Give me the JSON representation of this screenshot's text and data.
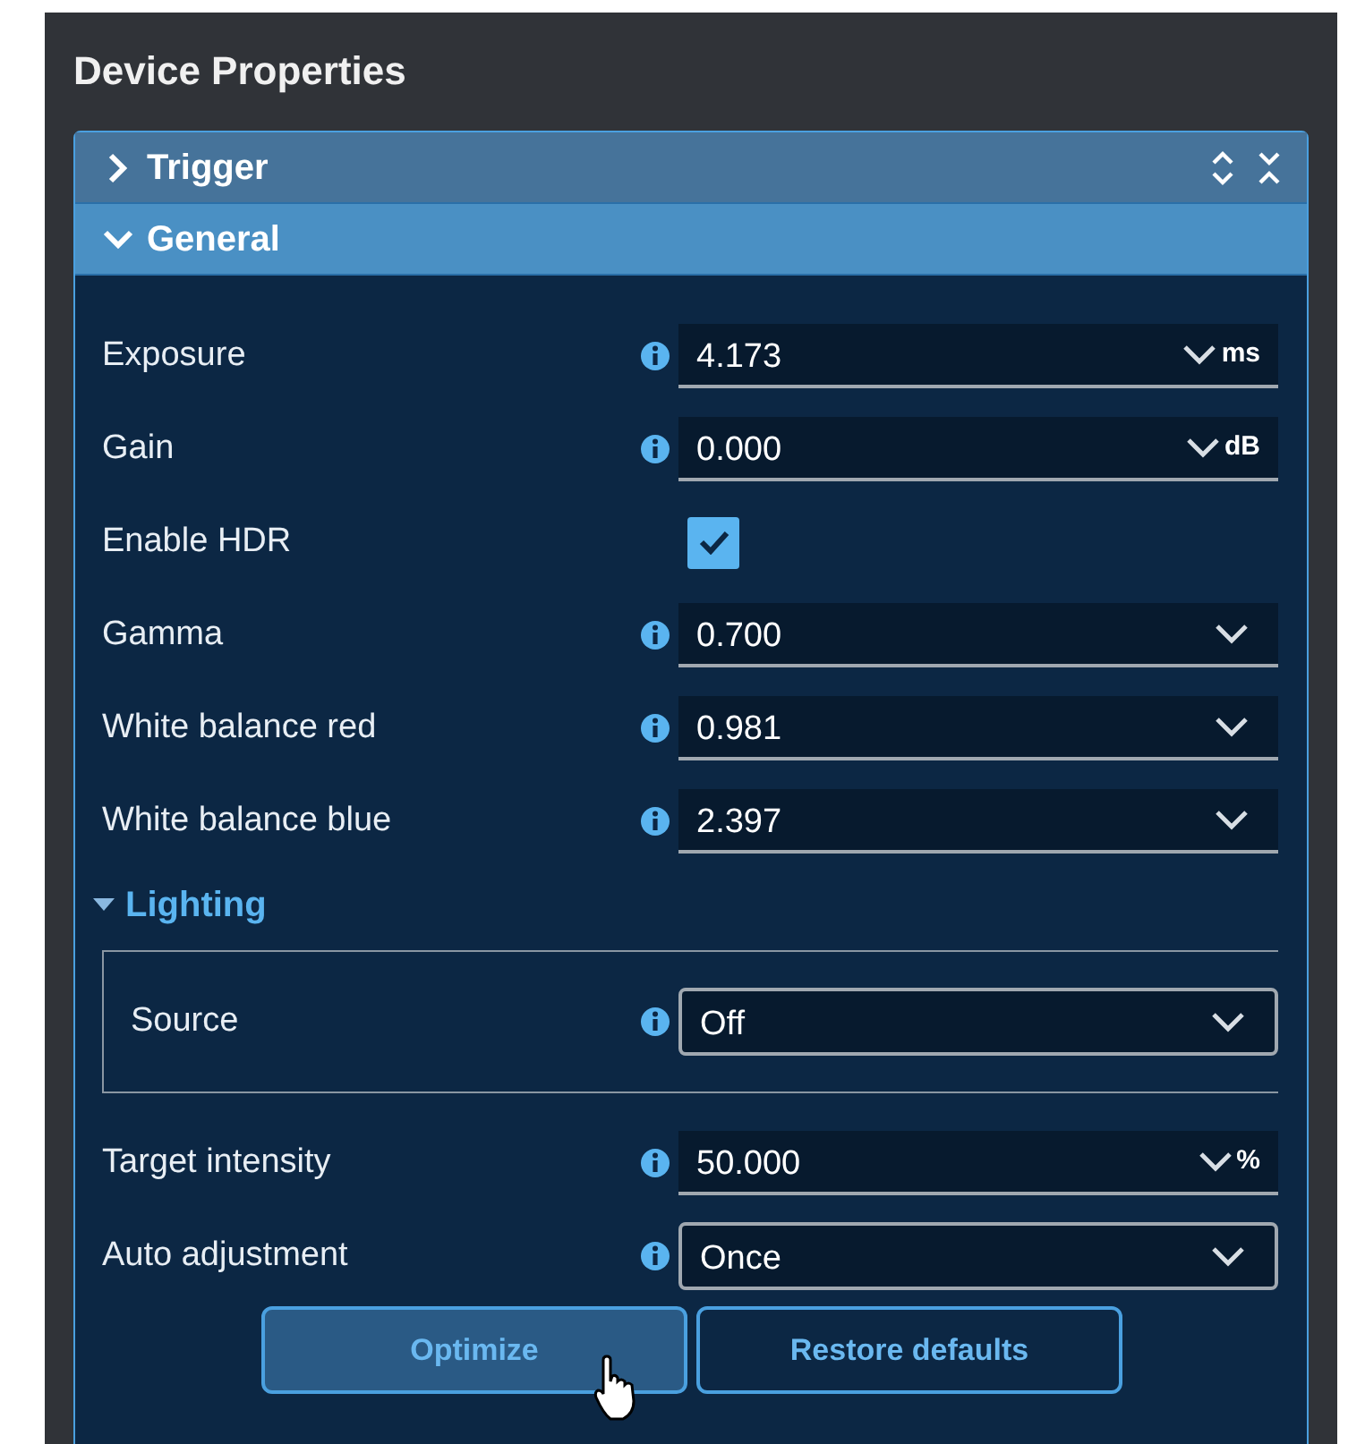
{
  "panel_title": "Device Properties",
  "sections": [
    {
      "title": "Trigger",
      "expanded": false
    },
    {
      "title": "General",
      "expanded": true
    }
  ],
  "properties": [
    {
      "kind": "number",
      "label": "Exposure",
      "value": "4.173",
      "unit": "ms"
    },
    {
      "kind": "number",
      "label": "Gain",
      "value": "0.000",
      "unit": "dB"
    },
    {
      "kind": "checkbox",
      "label": "Enable HDR",
      "checked": true
    },
    {
      "kind": "number",
      "label": "Gamma",
      "value": "0.700"
    },
    {
      "kind": "number",
      "label": "White balance red",
      "value": "0.981"
    },
    {
      "kind": "number",
      "label": "White balance blue",
      "value": "2.397"
    }
  ],
  "group": {
    "title": "Lighting",
    "expanded": true,
    "properties": [
      {
        "kind": "select",
        "label": "Source",
        "value": "Off"
      }
    ]
  },
  "more_properties": [
    {
      "kind": "number",
      "label": "Target intensity",
      "value": "50.000",
      "unit": "%"
    },
    {
      "kind": "select",
      "label": "Auto adjustment",
      "value": "Once"
    }
  ],
  "buttons": [
    {
      "label": "Optimize",
      "hovered": true
    },
    {
      "label": "Restore defaults",
      "hovered": false
    }
  ]
}
